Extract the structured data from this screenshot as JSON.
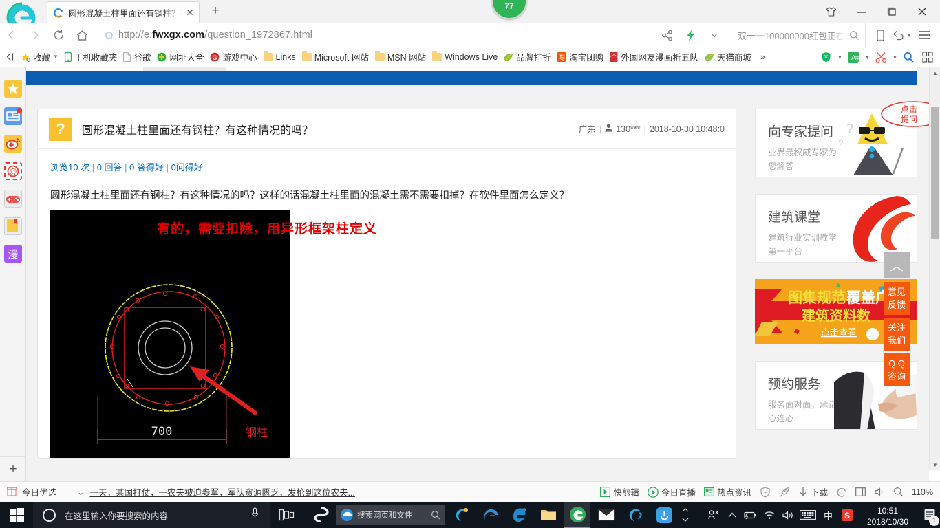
{
  "browser": {
    "tab": {
      "title": "圆形混凝土柱里面还有钢柱？有这",
      "close_label": "✕",
      "favicon": "browser-favicon"
    },
    "newtab_label": "+",
    "badge_count": "77",
    "url_prefix": "http://e.",
    "url_domain": "fwxgx.com",
    "url_path": "/question_1972867.html",
    "search_query": "双十一100000000红包正在",
    "window_controls": {
      "minimize": "–",
      "maximize": "❐",
      "close": "✕"
    },
    "bookmarks": [
      {
        "label": "收藏",
        "icon": "star-favorite-icon",
        "has_caret": true
      },
      {
        "label": "手机收藏夹",
        "icon": "phone-icon"
      },
      {
        "label": "谷歌",
        "icon": "page-icon"
      },
      {
        "label": "网址大全",
        "icon": "green-plus-icon"
      },
      {
        "label": "游戏中心",
        "icon": "red-g-icon"
      },
      {
        "label": "Links",
        "icon": "folder-icon"
      },
      {
        "label": "Microsoft 网站",
        "icon": "folder-icon"
      },
      {
        "label": "MSN 网站",
        "icon": "folder-icon"
      },
      {
        "label": "Windows Live",
        "icon": "folder-icon"
      },
      {
        "label": "品牌打折",
        "icon": "leaf-icon"
      },
      {
        "label": "淘宝团购",
        "icon": "taobao-icon"
      },
      {
        "label": "外国网友漫画析五队",
        "icon": "red-book-icon"
      },
      {
        "label": "天猫商城",
        "icon": "leaf-icon"
      },
      {
        "label": "»",
        "icon": "overflow-icon"
      }
    ]
  },
  "rail": {
    "items": [
      {
        "name": "favorites",
        "icon": "star-icon"
      },
      {
        "name": "news",
        "icon": "news-icon",
        "badge": true
      },
      {
        "name": "weibo",
        "icon": "weibo-eye-icon"
      },
      {
        "name": "mail",
        "icon": "at-mail-icon"
      },
      {
        "name": "games",
        "icon": "gamepad-icon"
      },
      {
        "name": "books",
        "icon": "book-icon"
      },
      {
        "name": "comics",
        "icon": "manga-icon",
        "label": "漫"
      }
    ],
    "add_label": "+"
  },
  "question": {
    "icon_label": "?",
    "title": "圆形混凝土柱里面还有钢柱？有这种情况的吗？",
    "region": "广东",
    "user": "130***",
    "datetime": "2018-10-30 10:48:0",
    "stats": {
      "views": "浏览10 次",
      "answers": "0 回答",
      "good_answers": "0 答得好",
      "good_questions": "0问得好"
    },
    "body": "圆形混凝土柱里面还有钢柱？有这种情况的吗？这样的话混凝土柱里面的混凝土需不需要扣掉？在软件里面怎么定义？",
    "figure": {
      "annotation": "有的，需要扣除，用异形框架柱定义",
      "dimension_label": "700",
      "callout_label": "钢柱"
    }
  },
  "sidebar": {
    "boxes": [
      {
        "title": "向专家提问",
        "subtitle": "业界最权威专家为您解答",
        "art": "expert-mascot",
        "bubble": "点击提问"
      },
      {
        "title": "建筑课堂",
        "subtitle": "建筑行业实训教学第一平台",
        "art": "swoosh-logo"
      }
    ],
    "banner": {
      "line1": "图集规范覆盖广",
      "line2": "建筑资料数",
      "cta": "点击查看"
    },
    "bottom_box": {
      "title": "预约服务",
      "subtitle": "服务面对面，承诺心连心",
      "art": "handshake-photo"
    },
    "float_buttons": [
      {
        "label": "意见\n反馈",
        "l1": "意见",
        "l2": "反馈",
        "name": "feedback"
      },
      {
        "label": "关注\n我们",
        "l1": "关注",
        "l2": "我们",
        "name": "follow-us"
      },
      {
        "label": "QQ\n咨询",
        "l1": "Q Q",
        "l2": "咨询",
        "name": "qq-consult"
      }
    ],
    "gotop_label": "︿"
  },
  "status_bar": {
    "gift_label": "今日优选",
    "news_caret": "⌄",
    "news": "一天，某国打仗，一农夫被迫参军，军队资源匮乏，发枪到这位农夫...",
    "right_items": [
      {
        "label": "快剪辑",
        "icon": "video-edit-icon"
      },
      {
        "label": "今日直播",
        "icon": "live-icon"
      },
      {
        "label": "热点资讯",
        "icon": "hot-news-icon"
      },
      {
        "label": "",
        "icon": "shield-icon"
      },
      {
        "label": "",
        "icon": "rocket-icon"
      },
      {
        "label": "下载",
        "icon": "download-icon"
      },
      {
        "label": "",
        "icon": "ie-compat-icon"
      },
      {
        "label": "",
        "icon": "split-window-icon"
      },
      {
        "label": "",
        "icon": "mute-icon"
      },
      {
        "label": "",
        "icon": "search-icon"
      },
      {
        "label": "110%",
        "icon": "zoom-level"
      }
    ]
  },
  "taskbar": {
    "search_placeholder": "在这里输入你要搜索的内容",
    "edge_search_placeholder": "搜索网页和文件",
    "apps": [
      {
        "name": "task-view-icon"
      },
      {
        "name": "app-s-icon"
      },
      {
        "name": "edge-blue-icon"
      },
      {
        "name": "ie-icon"
      },
      {
        "name": "file-explorer-icon"
      },
      {
        "name": "360-browser-icon",
        "running": true
      },
      {
        "name": "mail-icon"
      },
      {
        "name": "360-safe-icon"
      },
      {
        "name": "app-blue-icon"
      }
    ],
    "tray": [
      {
        "name": "people-icon",
        "glyph": "ꝑ"
      },
      {
        "name": "show-hidden-icons",
        "glyph": "⌃"
      },
      {
        "name": "battery-icon"
      },
      {
        "name": "wifi-icon"
      },
      {
        "name": "volume-icon"
      },
      {
        "name": "keyboard-icon"
      },
      {
        "name": "ime-chinese-icon",
        "glyph": "中"
      },
      {
        "name": "sogou-icon",
        "glyph": "S"
      }
    ],
    "clock_time": "10:51",
    "clock_date": "2018/10/30",
    "notification_count": "1"
  },
  "colors": {
    "site_blue": "#0c5fb0",
    "accent_orange": "#f4590f",
    "question_yellow": "#fbc02d",
    "link_blue": "#0b6fc4",
    "annotation_red": "#e00000"
  }
}
